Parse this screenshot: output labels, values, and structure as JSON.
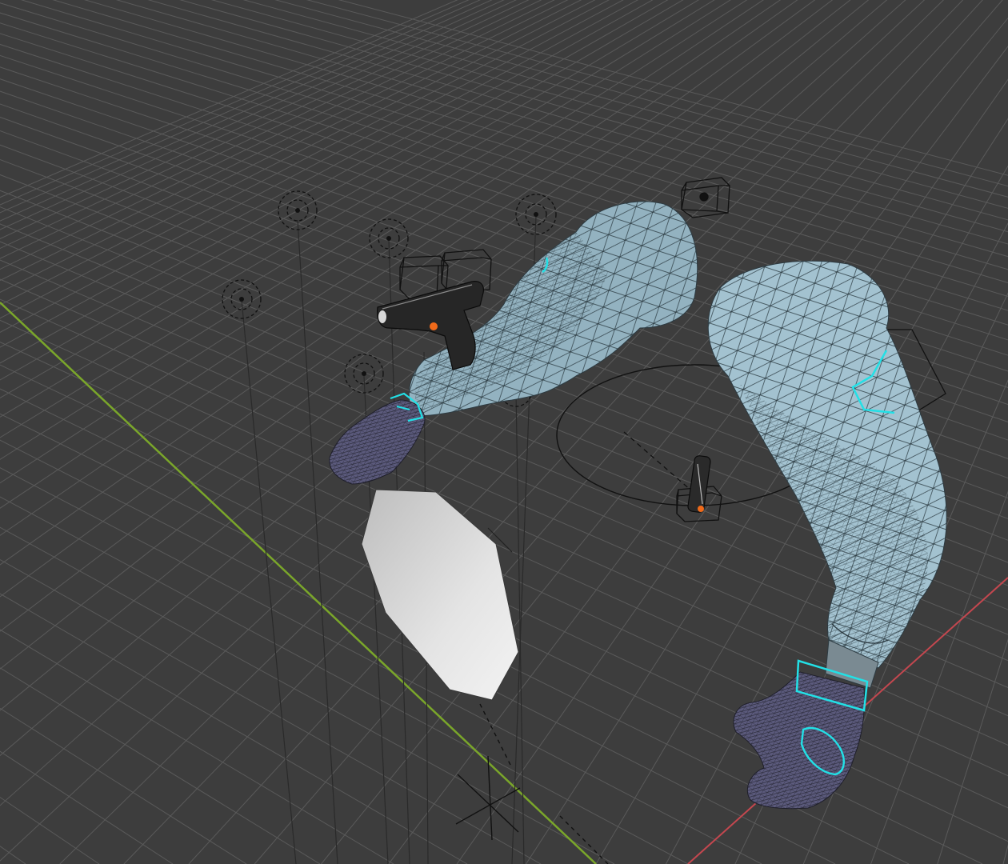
{
  "viewport": {
    "background_color": "#3d3d3d",
    "grid_line_color": "#5a5a5a",
    "x_axis_color": "#c4474f",
    "y_axis_color": "#7aa62a"
  },
  "objects": {
    "mesh_color": "#a3c2d0",
    "glove_color": "#5b5a7c",
    "selection_outline_color": "#22e0e6",
    "empty_color": "#111111",
    "light_shape_color": "#c9c9c9"
  },
  "icons": [
    "empty-sphere-icon",
    "empty-cube-icon",
    "empty-circle-icon",
    "empty-plain-axes-icon",
    "light-icon",
    "pistol-icon",
    "magazine-icon"
  ]
}
